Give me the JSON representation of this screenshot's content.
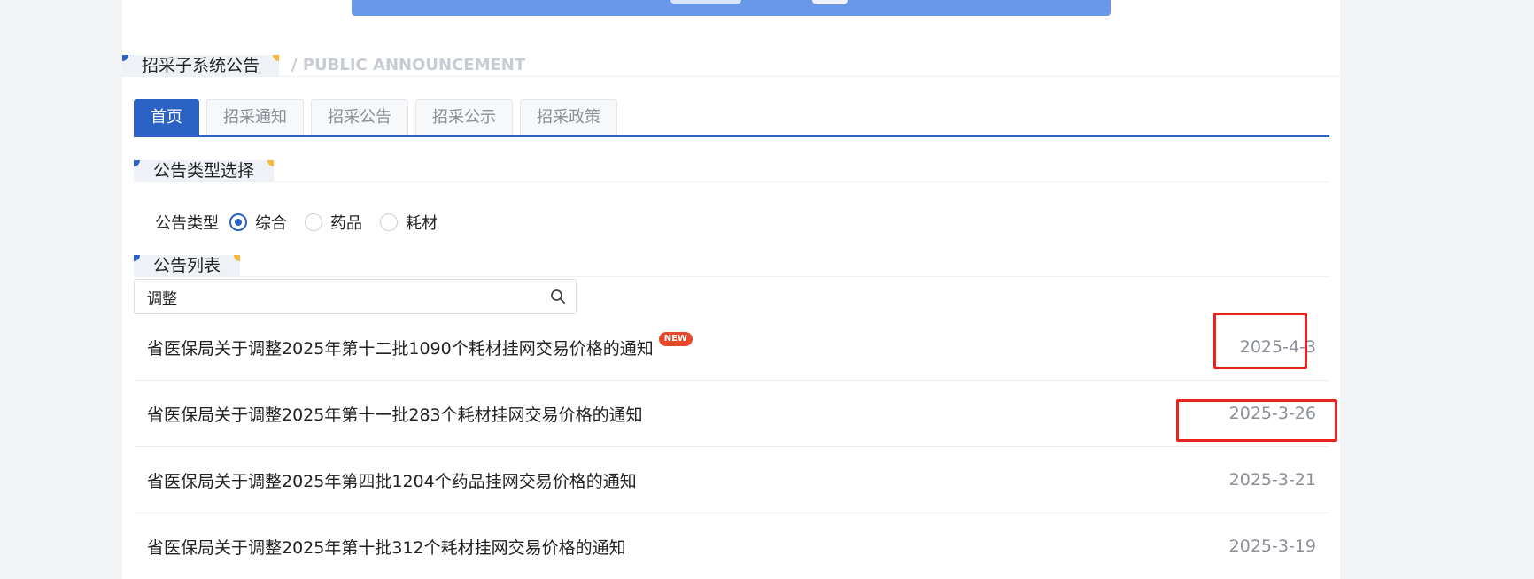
{
  "section_announcements": {
    "title": "招采子系统公告",
    "subtitle": "/ PUBLIC ANNOUNCEMENT"
  },
  "tabs": [
    {
      "label": "首页",
      "active": true
    },
    {
      "label": "招采通知",
      "active": false
    },
    {
      "label": "招采公告",
      "active": false
    },
    {
      "label": "招采公示",
      "active": false
    },
    {
      "label": "招采政策",
      "active": false
    }
  ],
  "section_type": {
    "title": "公告类型选择"
  },
  "type_filter": {
    "label": "公告类型",
    "options": [
      {
        "label": "综合",
        "checked": true
      },
      {
        "label": "药品",
        "checked": false
      },
      {
        "label": "耗材",
        "checked": false
      }
    ]
  },
  "section_list": {
    "title": "公告列表"
  },
  "search": {
    "value": "调整",
    "icon": "search-icon"
  },
  "notices": [
    {
      "title": "省医保局关于调整2025年第十二批1090个耗材挂网交易价格的通知",
      "date": "2025-4-3",
      "badge": "NEW"
    },
    {
      "title": "省医保局关于调整2025年第十一批283个耗材挂网交易价格的通知",
      "date": "2025-3-26",
      "badge": ""
    },
    {
      "title": "省医保局关于调整2025年第四批1204个药品挂网交易价格的通知",
      "date": "2025-3-21",
      "badge": ""
    },
    {
      "title": "省医保局关于调整2025年第十批312个耗材挂网交易价格的通知",
      "date": "2025-3-19",
      "badge": ""
    }
  ],
  "colors": {
    "accent": "#2c62c6",
    "corner_accent": "#f6b73c",
    "badge": "#e8492c",
    "annotation": "#e8221c"
  }
}
